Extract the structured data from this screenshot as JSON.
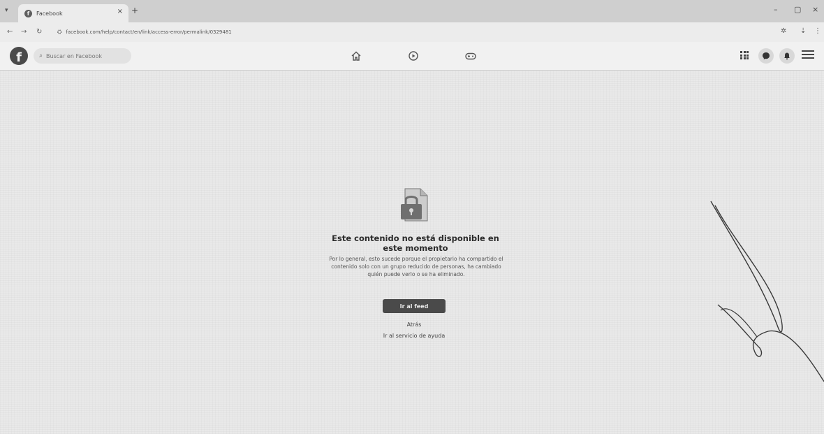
{
  "browser": {
    "tab_title": "Facebook",
    "tab_close": "×",
    "new_tab": "+",
    "url": "facebook.com/help/contact/en/link/access-error/permalink/0329481",
    "minimize": "–",
    "maximize": "▢",
    "close": "×"
  },
  "header": {
    "logo": "f",
    "search_placeholder": "Buscar en Facebook"
  },
  "message": {
    "title": "Este contenido no está disponible en este momento",
    "body": "Por lo general, esto sucede porque el propietario ha compartido el contenido solo con un grupo reducido de personas, ha cambiado quién puede verlo o se ha eliminado.",
    "feed_button": "Ir al feed",
    "back_link": "Atrás",
    "help_link": "Ir al servicio de ayuda"
  },
  "icons": {
    "favicon": "facebook-favicon",
    "home": "home-icon",
    "video": "video-icon",
    "gaming": "gaming-icon",
    "menu": "grid-menu-icon",
    "messenger": "messenger-icon",
    "notifications": "bell-icon",
    "account": "account-menu-icon"
  },
  "colors": {
    "page_background": "#e9e9e9",
    "header_background": "#f1f1f1",
    "button_background": "#4a4a4a"
  }
}
